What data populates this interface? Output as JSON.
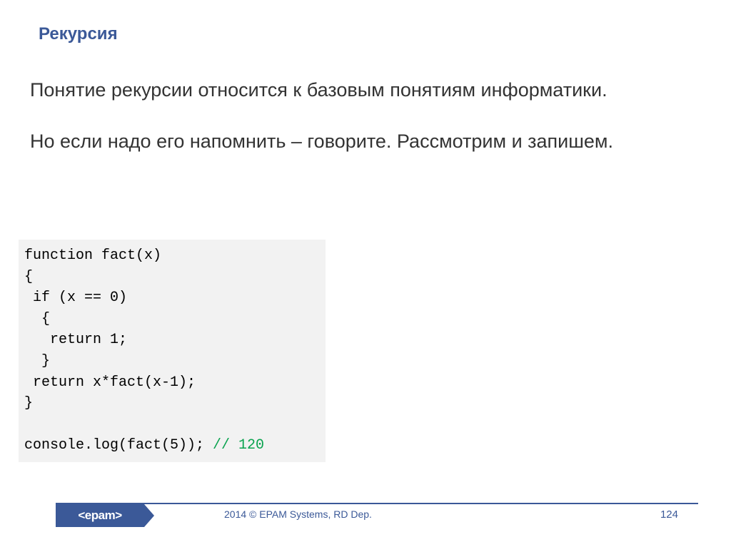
{
  "header": {
    "title": "Рекурсия"
  },
  "content": {
    "paragraph1": "Понятие рекурсии относится к базовым понятиям информатики.",
    "paragraph2": "Но если надо его напомнить – говорите. Рассмотрим и запишем."
  },
  "code": {
    "line1": "function fact(x)",
    "line2": "{",
    "line3": " if (x == 0)",
    "line4": "  {",
    "line5": "   return 1;",
    "line6": "  }",
    "line7": " return x*fact(x-1);",
    "line8": "}",
    "line9": "",
    "line10a": "console.log(fact(5)); ",
    "line10b": "// 120"
  },
  "footer": {
    "logo_text": "<epam>",
    "copyright": "2014 © EPAM Systems, RD Dep.",
    "page_number": "124"
  }
}
